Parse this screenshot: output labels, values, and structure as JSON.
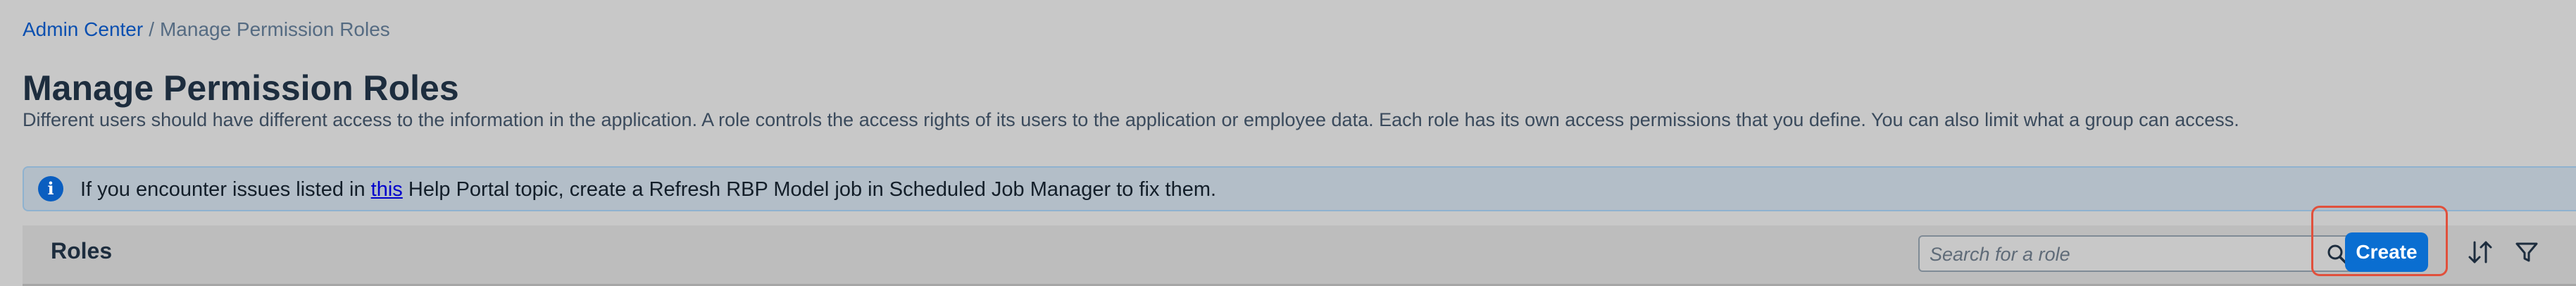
{
  "breadcrumb": {
    "link": "Admin Center",
    "separator": "/",
    "current": "Manage Permission Roles"
  },
  "page": {
    "title": "Manage Permission Roles",
    "description": "Different users should have different access to the information in the application. A role controls the access rights of its users to the application or employee data. Each role has its own access permissions that you define. You can also limit what a group can access."
  },
  "info_strip": {
    "icon": "info-icon",
    "text_before": "If you encounter issues listed in ",
    "link_text": "this",
    "text_after": " Help Portal topic, create a Refresh RBP Model job in Scheduled Job Manager to fix them."
  },
  "roles_toolbar": {
    "title": "Roles",
    "search_placeholder": "Search for a role",
    "search_icon": "search-icon",
    "create_label": "Create",
    "sort_icon": "sort-icon",
    "filter_icon": "filter-icon"
  },
  "colors": {
    "accent": "#0a6ed1",
    "link": "#0a4fb0",
    "highlight": "#e0503c",
    "info": "#0a5ec0"
  }
}
